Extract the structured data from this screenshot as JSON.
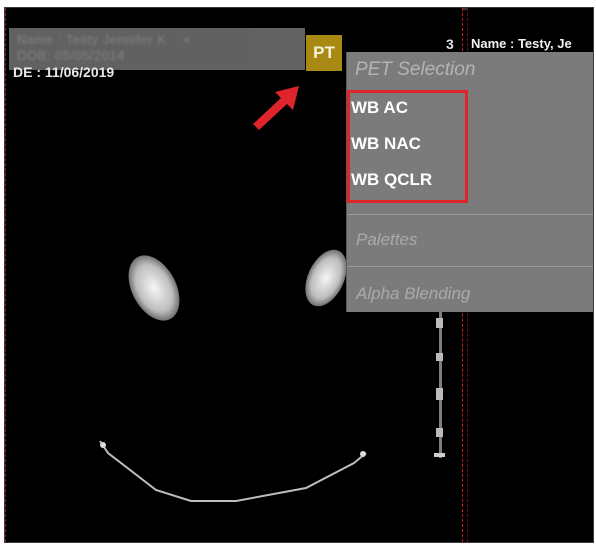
{
  "viewer": {
    "info_blurred": "Name : Testy Jennifer K    ×\nDOB: 05/05/2014",
    "date_label": "DE : 11/06/2019",
    "pt_button_label": "PT",
    "viewport_number": "3",
    "name_label": "Name : Testy, Je"
  },
  "pet_menu": {
    "header": "PET Selection",
    "items": [
      "WB AC",
      "WB NAC",
      "WB QCLR"
    ],
    "palettes_label": "Palettes",
    "alpha_blending_label": "Alpha Blending"
  },
  "colors": {
    "highlight": "#e0242c",
    "pt_button": "#a88a12",
    "menu_bg": "#7b7b7b",
    "arrow": "#e0242c"
  },
  "icons": {
    "callout_arrow": "arrow-up-right-icon"
  }
}
